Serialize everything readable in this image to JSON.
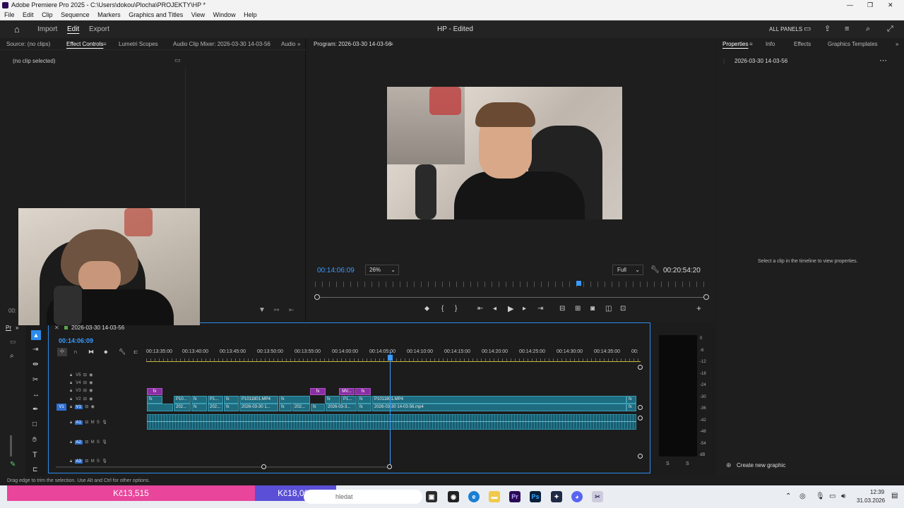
{
  "window": {
    "title": "Adobe Premiere Pro 2025 - C:\\Users\\dokou\\Plocha\\PROJEKTY\\HP *",
    "controls": [
      "—",
      "❐",
      "✕"
    ]
  },
  "menu": [
    "File",
    "Edit",
    "Clip",
    "Sequence",
    "Markers",
    "Graphics and Titles",
    "View",
    "Window",
    "Help"
  ],
  "header": {
    "workspaces": [
      "Import",
      "Edit",
      "Export"
    ],
    "active_workspace": "Edit",
    "project_title": "HP - Edited",
    "all_panels": "ALL PANELS"
  },
  "source_panel": {
    "tabs": [
      "Source: (no clips)",
      "Effect Controls",
      "Lumetri Scopes",
      "Audio Clip Mixer: 2026-03-30 14-03-56",
      "Audio"
    ],
    "active_tab": "Effect Controls",
    "no_clip": "(no clip selected)",
    "timecode": "00:"
  },
  "program_monitor": {
    "title": "Program: 2026-03-30 14-03-56",
    "current_time": "00:14:06:09",
    "zoom": "26%",
    "quality": "Full",
    "duration": "00:20:54:20"
  },
  "properties_panel": {
    "tabs": [
      "Properties",
      "Info",
      "Effects",
      "Graphics Templates"
    ],
    "active_tab": "Properties",
    "sequence_name": "2026-03-30 14-03-56",
    "hint": "Select a clip in the timeline to view properties.",
    "create_graphic": "Create new graphic"
  },
  "project_panel": {
    "tab": "Pr",
    "tab_suffix": "»"
  },
  "timeline": {
    "sequence_name": "2026-03-30 14-03-56",
    "timecode": "00:14:06:09",
    "ruler": [
      "00:13:35:00",
      "00:13:40:00",
      "00:13:45:00",
      "00:13:50:00",
      "00:13:55:00",
      "00:14:00:00",
      "00:14:05:00",
      "00:14:10:00",
      "00:14:15:00",
      "00:14:20:00",
      "00:14:25:00",
      "00:14:30:00",
      "00:14:35:00",
      "00:"
    ],
    "video_tracks": [
      "V5",
      "V4",
      "V3",
      "V2",
      "V1"
    ],
    "audio_tracks": [
      "A1",
      "A2",
      "A3"
    ],
    "source_patch": "V1",
    "clips_v2": [
      {
        "label": "fx",
        "name": ""
      },
      {
        "label": "P10...",
        "name": ""
      },
      {
        "label": "fx",
        "name": ""
      },
      {
        "label": "P1...",
        "name": ""
      },
      {
        "label": "fx",
        "name": ""
      },
      {
        "label": "P1011801.MP4",
        "name": ""
      },
      {
        "label": "fx",
        "name": ""
      },
      {
        "label": "fx",
        "name": ""
      },
      {
        "label": "P1...",
        "name": ""
      },
      {
        "label": "fx",
        "name": ""
      },
      {
        "label": "P1011801.MP4",
        "name": ""
      },
      {
        "label": "fx",
        "name": ""
      }
    ],
    "clips_v1": [
      {
        "label": "202..."
      },
      {
        "label": "fx"
      },
      {
        "label": "202..."
      },
      {
        "label": "fx"
      },
      {
        "label": "2026-03-30 1..."
      },
      {
        "label": "fx"
      },
      {
        "label": "202..."
      },
      {
        "label": "fx"
      },
      {
        "label": "2026-03-3..."
      },
      {
        "label": "fx"
      },
      {
        "label": "2026-03-30 14-03-56.mp4"
      },
      {
        "label": "fx"
      }
    ],
    "clips_v3": [
      "fx",
      "fx",
      "MV...",
      "fx"
    ],
    "audio_meter_labels": [
      "0",
      "-6",
      "-12",
      "-18",
      "-24",
      "-30",
      "-36",
      "-42",
      "-48",
      "-54",
      "dB"
    ],
    "meter_solo": [
      "S",
      "S"
    ]
  },
  "status_bar": "Drag edge to trim the selection. Use Alt and Ctrl for other options.",
  "taskbar": {
    "price_ad_left": "Kč13,515",
    "price_ad_right": "Kč18,000",
    "search_placeholder": "hledat",
    "time": "12:39",
    "date": "31.03.2026"
  },
  "colors": {
    "accent_blue": "#2d8ceb",
    "timecode_blue": "#3a9bff",
    "clip_teal": "#1e6c80",
    "clip_purple": "#8a2ea3",
    "price_pink": "#e8459b",
    "price_purple": "#5a4fd6"
  }
}
